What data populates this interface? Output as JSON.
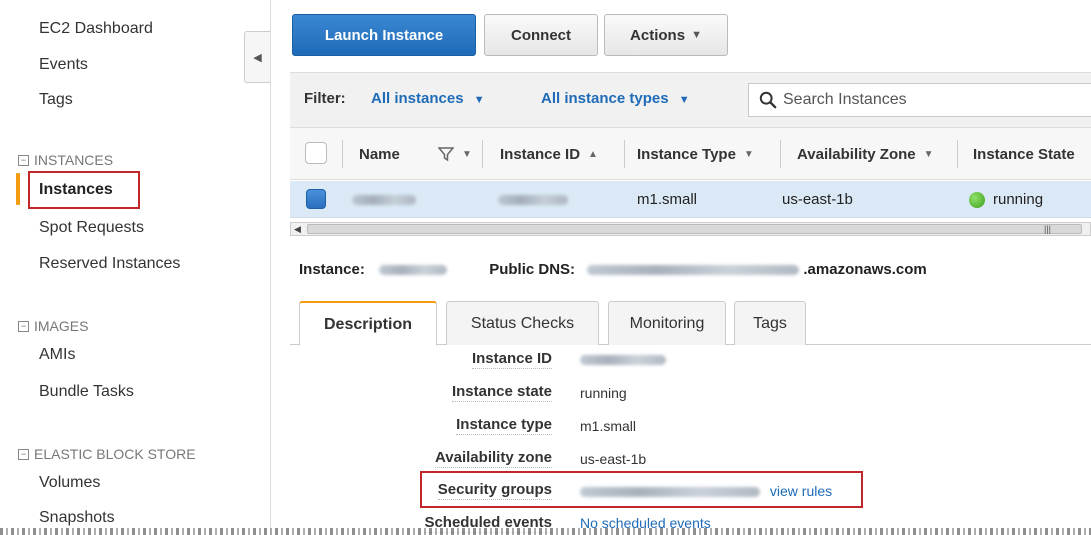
{
  "top_strip_text": "y group ... ... ... ..y",
  "sidebar": {
    "items": [
      {
        "label": "EC2 Dashboard"
      },
      {
        "label": "Events"
      },
      {
        "label": "Tags"
      }
    ],
    "sections": [
      {
        "title": "INSTANCES",
        "items": [
          "Instances",
          "Spot Requests",
          "Reserved Instances"
        ]
      },
      {
        "title": "IMAGES",
        "items": [
          "AMIs",
          "Bundle Tasks"
        ]
      },
      {
        "title": "ELASTIC BLOCK STORE",
        "items": [
          "Volumes",
          "Snapshots"
        ]
      }
    ],
    "active_item": "Instances"
  },
  "toolbar": {
    "launch_label": "Launch Instance",
    "connect_label": "Connect",
    "actions_label": "Actions"
  },
  "filter": {
    "label": "Filter:",
    "instances_dropdown": "All instances",
    "types_dropdown": "All instance types",
    "search_placeholder": "Search Instances"
  },
  "table": {
    "columns": [
      "Name",
      "Instance ID",
      "Instance Type",
      "Availability Zone",
      "Instance State"
    ],
    "rows": [
      {
        "name": "",
        "instance_id": "",
        "instance_type": "m1.small",
        "availability_zone": "us-east-1b",
        "state": "running"
      }
    ]
  },
  "instance_summary": {
    "instance_label": "Instance:",
    "dns_label": "Public DNS:",
    "dns_suffix": ".amazonaws.com"
  },
  "tabs": [
    "Description",
    "Status Checks",
    "Monitoring",
    "Tags"
  ],
  "details": [
    {
      "label": "Instance ID",
      "value": ""
    },
    {
      "label": "Instance state",
      "value": "running"
    },
    {
      "label": "Instance type",
      "value": "m1.small"
    },
    {
      "label": "Availability zone",
      "value": "us-east-1b"
    },
    {
      "label": "Security groups",
      "value": "",
      "link": "view rules"
    },
    {
      "label": "Scheduled events",
      "value": "No scheduled events"
    }
  ],
  "colors": {
    "accent": "#1f6bb8",
    "highlight": "#c0272d",
    "active_bar": "#f39c12",
    "status_running": "#3aa018"
  }
}
